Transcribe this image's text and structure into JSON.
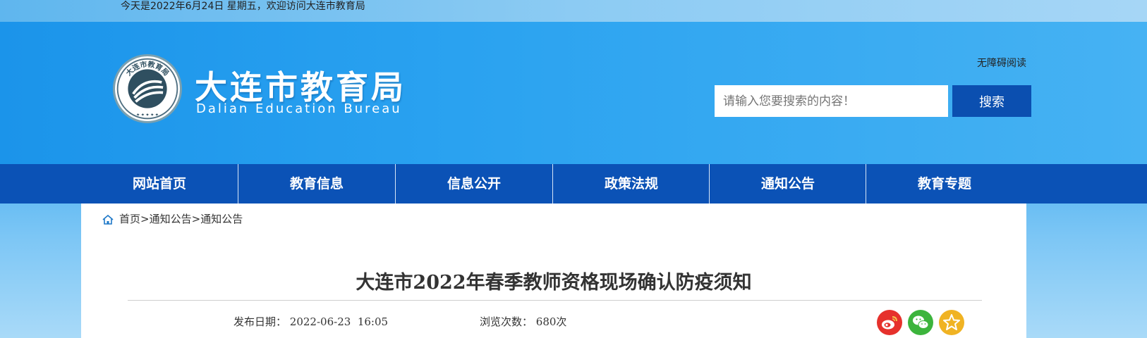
{
  "topbar": {
    "date_text": "今天是2022年6月24日 星期五，欢迎访问大连市教育局"
  },
  "header": {
    "logo_cn": "大连市教育局",
    "logo_en": "Dalian Education Bureau",
    "emblem_text": "大连市教育局",
    "accessible_label": "无障碍阅读",
    "search": {
      "placeholder": "请输入您要搜索的内容！",
      "button_label": "搜索"
    }
  },
  "nav": {
    "items": [
      {
        "label": "网站首页"
      },
      {
        "label": "教育信息"
      },
      {
        "label": "信息公开"
      },
      {
        "label": "政策法规"
      },
      {
        "label": "通知公告"
      },
      {
        "label": "教育专题"
      }
    ]
  },
  "breadcrumb": {
    "home": "首页",
    "sep": ">",
    "level1": "通知公告",
    "level2": "通知公告"
  },
  "article": {
    "title": "大连市2022年春季教师资格现场确认防疫须知",
    "publish_label": "发布日期：",
    "publish_value": "2022-06-23  16:05",
    "views_label": "浏览次数：",
    "views_value": "680次"
  },
  "share": {
    "icons": [
      "weibo-icon",
      "wechat-icon",
      "favorite-star-icon"
    ],
    "colors": [
      "#e6312c",
      "#3cb43c",
      "#f0b323"
    ]
  },
  "colors": {
    "nav_bg": "#0b52b6",
    "search_btn": "#0b4fb0",
    "header_bg": "#2aa2f0"
  }
}
